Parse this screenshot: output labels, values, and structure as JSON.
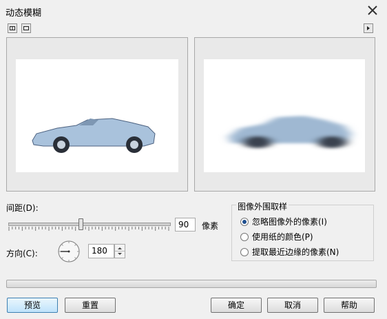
{
  "dialog": {
    "title": "动态模糊"
  },
  "controls": {
    "distance_label": "间距(D):",
    "distance_value": "90",
    "unit_label": "像素",
    "slider_level": 0.45,
    "direction_label": "方向(C):",
    "direction_value": "180"
  },
  "sampling": {
    "group_title": "图像外围取样",
    "options": [
      {
        "label": "忽略图像外的像素(I)",
        "selected": true
      },
      {
        "label": "使用纸的颜色(P)",
        "selected": false
      },
      {
        "label": "提取最近边缘的像素(N)",
        "selected": false
      }
    ]
  },
  "buttons": {
    "preview": "预览",
    "reset": "重置",
    "ok": "确定",
    "cancel": "取消",
    "help": "帮助"
  },
  "colors": {
    "accent": "#1f4f8f",
    "car_body": "#b8cfe6"
  }
}
